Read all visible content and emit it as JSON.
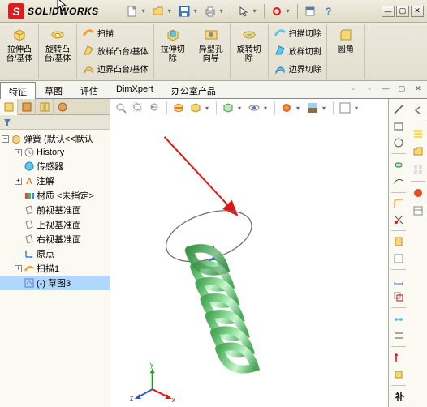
{
  "brand": "SOLIDWORKS",
  "sw_logo_text": "S",
  "ribbon": {
    "extrude_boss": "拉伸凸台/基体",
    "revolve_boss": "旋转凸台/基体",
    "swept": "扫描",
    "lofted": "放样凸台/基体",
    "boundary": "边界凸台/基体",
    "extrude_cut": "拉伸切除",
    "hole_wizard": "异型孔向导",
    "revolve_cut": "旋转切除",
    "swept_cut": "扫描切除",
    "lofted_cut": "放样切割",
    "boundary_cut": "边界切除",
    "fillet": "圆角"
  },
  "tabs": {
    "features": "特征",
    "sketch": "草图",
    "evaluate": "评估",
    "dimxpert": "DimXpert",
    "office": "办公室产品"
  },
  "tree": {
    "root": "弹簧  (默认<<默认",
    "history": "History",
    "sensors": "传感器",
    "annotations": "注解",
    "material": "材质 <未指定>",
    "front_plane": "前视基准面",
    "top_plane": "上视基准面",
    "right_plane": "右视基准面",
    "origin": "原点",
    "sweep1": "扫描1",
    "sketch3": "(-) 草图3"
  },
  "colors": {
    "accent_red": "#da1d21",
    "spring_green": "#6dc97a",
    "spring_dark": "#2a7a3a",
    "arrow_red": "#e01515"
  }
}
